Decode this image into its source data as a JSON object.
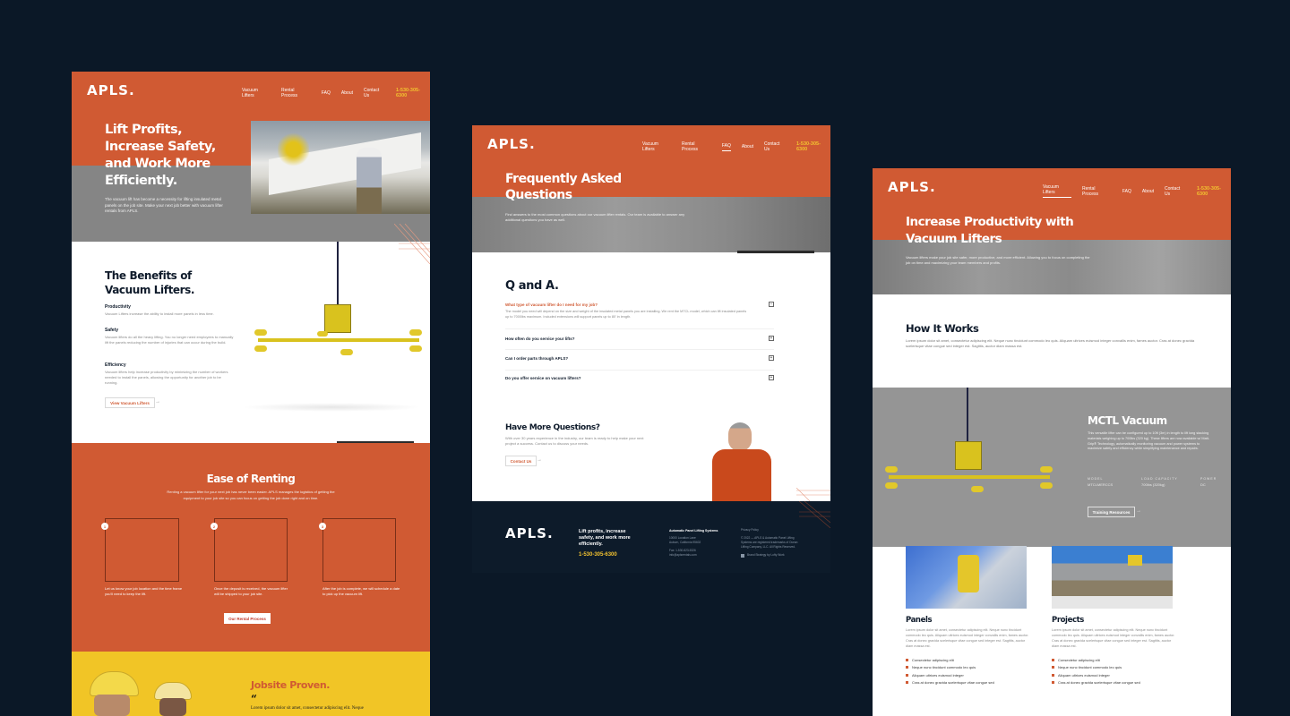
{
  "brand": {
    "logo": "APLS.",
    "phone": "1-530-305-6300",
    "accent": "#d05a33",
    "highlight": "#f2c230",
    "dark": "#0f1b2b",
    "page_bg": "#0b1827"
  },
  "nav": {
    "items": [
      "Vacuum Lifters",
      "Rental Process",
      "FAQ",
      "About",
      "Contact Us"
    ]
  },
  "home": {
    "hero_title_lines": [
      "Lift Profits,",
      "Increase Safety,",
      "and Work More",
      "Efficiently."
    ],
    "hero_body": "The vacuum lift has become a necessity for lifting insulated metal panels on the job site. Make your next job better with vacuum lifter rentals from APLS.",
    "benefits_title_lines": [
      "The Benefits of",
      "Vacuum Lifters."
    ],
    "benefits": [
      {
        "title": "Productivity",
        "text": "Vacuum Lifters increase the ability to install more panels in less time."
      },
      {
        "title": "Safety",
        "text": "Vacuum lifters do all the heavy lifting. You no longer need employees to manually lift the panels reducing the number of injuries that can occur during the build."
      },
      {
        "title": "Efficiency",
        "text": "Vacuum lifters help increase productivity by minimizing the number of workers needed to install the panels, allowing the opportunity for another job to be running."
      }
    ],
    "benefits_button": "View Vacuum Lifters",
    "renting_title": "Ease of Renting",
    "renting_body": "Renting a vacuum lifter for your next job has never been easier. APLS manages the logistics of getting the equipment to your job site so you can focus on getting the job done right and on time.",
    "steps": [
      {
        "num": "1",
        "text": "Let us know your job location and the time frame you'll need to keep the lift."
      },
      {
        "num": "2",
        "text": "Once the deposit is received, the vacuum lifter will be shipped to your job site."
      },
      {
        "num": "3",
        "text": "After the job is complete, we will schedule a date to pick up the vacuum lift."
      }
    ],
    "renting_button": "Our Rental Process",
    "jobsite_title": "Jobsite Proven.",
    "quote_mark": "“",
    "quote_text": "Lorem ipsum dolor sit amet, consectetur adipiscing elit. Neque"
  },
  "faq": {
    "hero_title_lines": [
      "Frequently Asked",
      "Questions"
    ],
    "hero_body": "Find answers to the most common questions about our vacuum lifter rentals. Our team is available to answer any additional questions you have as well.",
    "section_title": "Q and A.",
    "items": [
      {
        "q": "What type of vacuum lifter do I need for my job?",
        "a": "The model you need will depend on the size and weight of the insulated metal panels you are installing. We rent the MTCL model, which can lift insulated panels up to 7000lbs maximum. Included extensions will support panels up to 80' in length.",
        "open": true
      },
      {
        "q": "How often do you service your lifts?",
        "a": "",
        "open": false
      },
      {
        "q": "Can I order parts through APLS?",
        "a": "",
        "open": false
      },
      {
        "q": "Do you offer service on vacuum lifters?",
        "a": "",
        "open": false
      }
    ],
    "more_title": "Have More Questions?",
    "more_body": "With over 30 years experience in the industry, our team is ready to help make your next project a success. Contact us to discuss your needs.",
    "more_button": "Contact Us"
  },
  "footer": {
    "tagline_lines": [
      "Lift profits, increase",
      "safety, and work more",
      "efficiently."
    ],
    "company": "Automatic Panel Lifting Systems",
    "address_lines": [
      "10000 Location Lane",
      "Auburn, California 95602"
    ],
    "contact_lines": [
      "Fax: 1-530-823-5326",
      "info@aplsrentals.com"
    ],
    "privacy": "Privacy Policy",
    "legal_lines": [
      "© 2022 — APLS & Automatic Panel Lifting",
      "Systems are registered trademarks of Ocean",
      "Lifting Company, LLC. All Rights Reserved."
    ],
    "credit": "Brand Strategy by Lofty Work"
  },
  "lifters": {
    "hero_title_lines": [
      "Increase Productivity with",
      "Vacuum Lifters"
    ],
    "hero_body": "Vacuum lifters make your job site safer, more productive, and more efficient. Allowing you to focus on completing the job on time and maximizing your team members and profits.",
    "how_title": "How It Works",
    "how_body": "Lorem ipsum dolor sit amet, consectetur adipiscing elit. Neque nunc tincidunt commodo leo quis. Aliquam ultrices euismod integer convallis enim, fames auctor. Cras at donec gravida scelerisque vitae congue sed integer est. Sagittis, auctor diam massa est.",
    "product_title": "MCTL Vacuum",
    "product_body": "This versatile lifter can be configured up to 10ft (3m) in length to lift long stacking materials weighing up to 700lbs (320 kg). These lifters are now available w/ Matt-Grip® Technology, automatically monitoring vacuum and power systems to maximize safety and efficiency while simplifying maintenance and repairs.",
    "specs": [
      {
        "label": "MODEL",
        "value": "MTCLMERCCS"
      },
      {
        "label": "LOAD CAPACITY",
        "value": "700lbs (320kg)"
      },
      {
        "label": "POWER",
        "value": "DC"
      }
    ],
    "product_button": "Training Resources",
    "cards": [
      {
        "title": "Panels",
        "text": "Lorem ipsum dolor sit amet, consectetur adipiscing elit. Neque nunc tincidunt commodo leo quis. Aliquam ultrices euismod integer convallis enim, fames auctor. Cras at donec gravida scelerisque vitae congue sed integer est. Sagittis, auctor diam massa est.",
        "bullets": [
          "Consectetur adipiscing elit",
          "Neque nunc tincidunt commodo leo quis",
          "Aliquam ultrices euismod integer",
          "Cras at donec gravida scelerisque vitae congue sed"
        ]
      },
      {
        "title": "Projects",
        "text": "Lorem ipsum dolor sit amet, consectetur adipiscing elit. Neque nunc tincidunt commodo leo quis. Aliquam ultrices euismod integer convallis enim, fames auctor. Cras at donec gravida scelerisque vitae congue sed integer est. Sagittis, auctor diam massa est.",
        "bullets": [
          "Consectetur adipiscing elit",
          "Neque nunc tincidunt commodo leo quis",
          "Aliquam ultrices euismod integer",
          "Cras at donec gravida scelerisque vitae congue sed"
        ]
      }
    ]
  }
}
